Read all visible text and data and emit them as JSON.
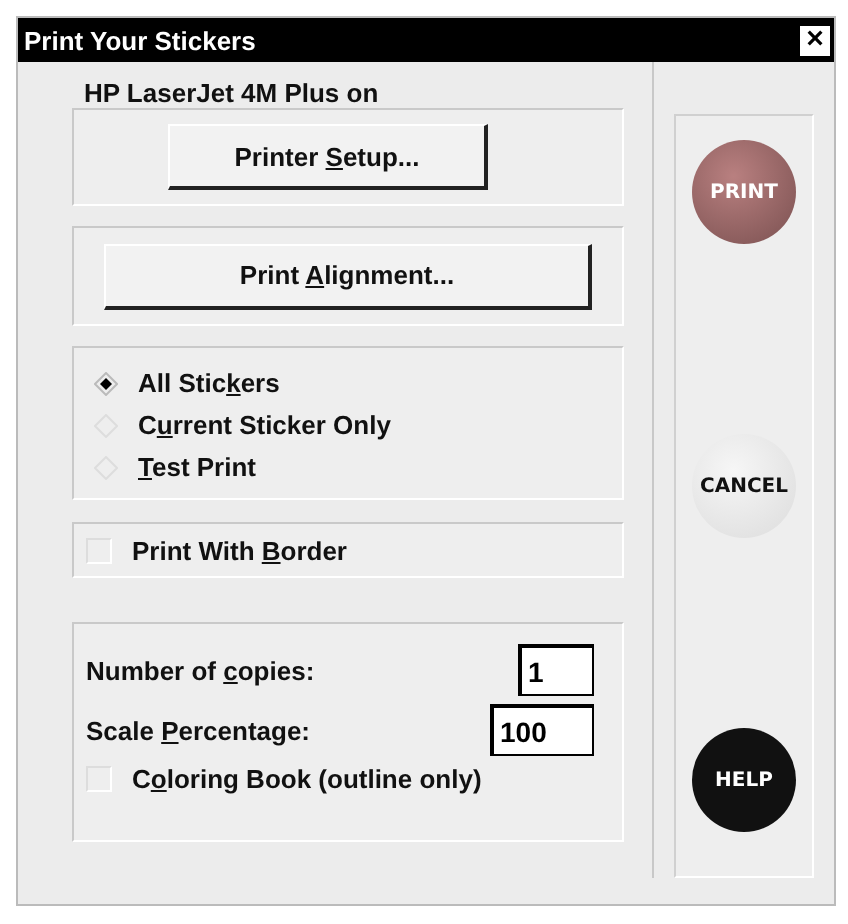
{
  "window": {
    "title": "Print Your Stickers",
    "close": "×"
  },
  "printer": {
    "label": "HP LaserJet 4M Plus on",
    "setup_button": [
      "Printer ",
      "S",
      "etup..."
    ]
  },
  "alignment_button": [
    "Print ",
    "A",
    "lignment..."
  ],
  "print_range": [
    {
      "label": [
        "All Stic",
        "k",
        "ers"
      ],
      "selected": true
    },
    {
      "label": [
        "C",
        "u",
        "rrent Sticker Only"
      ],
      "selected": false
    },
    {
      "label": {
        "key": "T",
        "after": "est Print"
      },
      "selected": false
    }
  ],
  "border_option": {
    "label": [
      "Print With ",
      "B",
      "order"
    ],
    "checked": false
  },
  "copies": {
    "label": [
      "Number of ",
      "c",
      "opies:"
    ],
    "value": "1"
  },
  "scale": {
    "label": [
      "Scale ",
      "P",
      "ercentage:"
    ],
    "value": "100"
  },
  "coloring_book": {
    "label": [
      "C",
      "o",
      "loring Book (outline only)"
    ],
    "checked": false
  },
  "actions": [
    {
      "kind": "print",
      "label": "PRINT"
    },
    {
      "kind": "cancel",
      "label": "CANCEL"
    },
    {
      "kind": "help",
      "label": "HELP"
    }
  ]
}
